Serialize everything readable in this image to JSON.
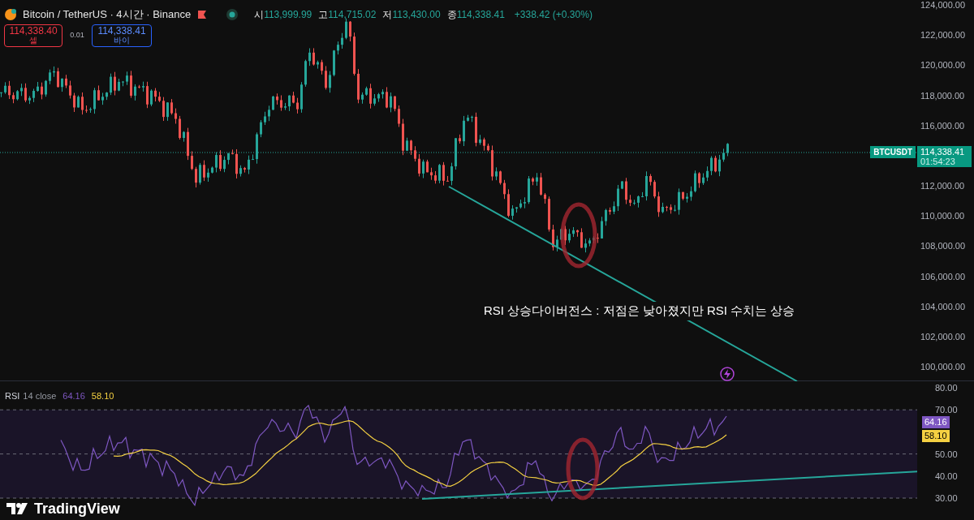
{
  "header": {
    "symbol": "Bitcoin / TetherUS · 4시간 · Binance",
    "ohlc": [
      {
        "label": "시",
        "value": "113,999.99"
      },
      {
        "label": "고",
        "value": "114,715.02"
      },
      {
        "label": "저",
        "value": "113,430.00"
      },
      {
        "label": "종",
        "value": "114,338.41"
      }
    ],
    "change": "+338.42 (+0.30%)"
  },
  "trade": {
    "sell": {
      "price": "114,338.40",
      "label": "셀"
    },
    "spread": "0.01",
    "buy": {
      "price": "114,338.41",
      "label": "바이"
    }
  },
  "price_axis": [
    "124,000.00",
    "122,000.00",
    "120,000.00",
    "118,000.00",
    "116,000.00",
    "112,000.00",
    "110,000.00",
    "108,000.00",
    "106,000.00",
    "104,000.00",
    "102,000.00",
    "100,000.00"
  ],
  "last_price": {
    "symbol": "BTCUSDT",
    "price": "114,338.41",
    "countdown": "01:54:23"
  },
  "annotation": "RSI 상승다이버전스 : 저점은 낮아졌지만 RSI 수치는 상승",
  "rsi": {
    "name": "RSI",
    "params": "14 close",
    "value": "64.16",
    "ma_value": "58.10",
    "axis": [
      "80.00",
      "70.00",
      "50.00",
      "40.00",
      "30.00"
    ],
    "value_label": "64.16",
    "ma_label": "58.10"
  },
  "logo": "TradingView"
}
